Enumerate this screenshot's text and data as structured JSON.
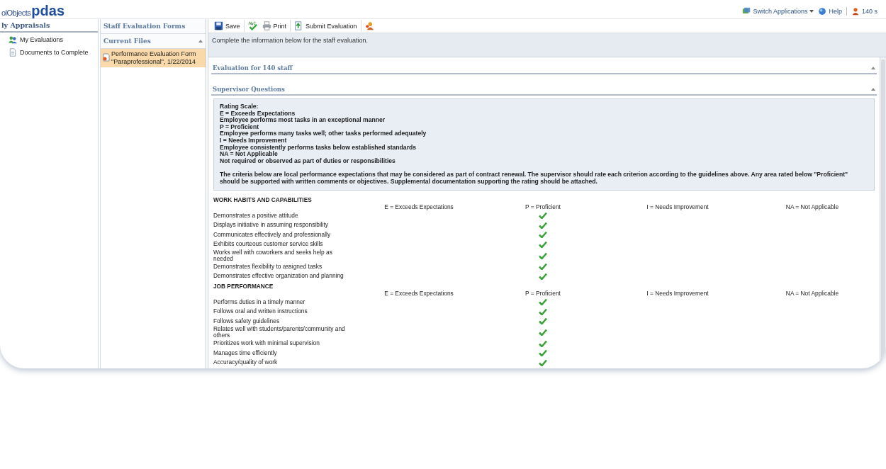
{
  "header": {
    "logo_prefix": "olObjects",
    "logo_main": "pdas",
    "links": [
      {
        "kind": "switch",
        "label": "Switch Applications"
      },
      {
        "kind": "help",
        "label": "Help"
      },
      {
        "kind": "user",
        "label": "140 s"
      }
    ]
  },
  "sidebar": {
    "title": "ly Appraisals",
    "items": [
      {
        "kind": "people",
        "label": "My Evaluations"
      },
      {
        "kind": "document",
        "label": "Documents to Complete"
      }
    ]
  },
  "files_panel": {
    "title": "Staff Evaluation Forms",
    "section": "Current Files",
    "files": [
      {
        "label": "Performance Evaluation Form \"Paraprofessional\", 1/22/2014",
        "selected": true
      }
    ]
  },
  "toolbar": [
    {
      "kind": "save",
      "label": "Save"
    },
    {
      "kind": "spellcheck"
    },
    {
      "kind": "print",
      "label": "Print"
    },
    {
      "kind": "submit",
      "label": "Submit Evaluation"
    },
    {
      "kind": "person"
    }
  ],
  "instructions": "Complete the information below for the staff evaluation.",
  "evaluation_title": "Evaluation for 140 staff",
  "questions_title": "Supervisor Questions",
  "rating_scale": [
    "Rating Scale:",
    "E = Exceeds Expectations",
    "Employee performs most tasks in an exceptional manner",
    "P = Proficient",
    "Employee performs many tasks well; other tasks performed adequately",
    "I = Needs Improvement",
    "Employee consistently performs tasks below established standards",
    "NA = Not Applicable",
    "Not required or observed as part of duties or responsibilities"
  ],
  "criteria_note": "The criteria below are local performance expectations that may be considered as part of contract renewal. The supervisor should rate each criterion according to the guidelines above. Any area rated below \"Proficient\" should be supported with written comments or objectives. Supplemental documentation supporting the rating should be attached.",
  "sections": [
    {
      "title": "WORK HABITS AND CAPABILITIES",
      "columns": [
        "E = Exceeds Expectations",
        "P = Proficient",
        "I = Needs Improvement",
        "NA = Not Applicable"
      ],
      "criteria": [
        {
          "label": "Demonstrates a positive attitude",
          "checked": [
            false,
            true,
            false,
            false
          ]
        },
        {
          "label": "Displays initiative in assuming responsibility",
          "checked": [
            false,
            true,
            false,
            false
          ]
        },
        {
          "label": "Communicates effectively and professionally",
          "checked": [
            false,
            true,
            false,
            false
          ]
        },
        {
          "label": "Exhibits courteous customer service skills",
          "checked": [
            false,
            true,
            false,
            false
          ]
        },
        {
          "label": "Works well with coworkers and seeks help as needed",
          "checked": [
            false,
            true,
            false,
            false
          ]
        },
        {
          "label": "Demonstrates flexibility to assigned tasks",
          "checked": [
            false,
            true,
            false,
            false
          ]
        },
        {
          "label": "Demonstrates effective organization and planning",
          "checked": [
            false,
            true,
            false,
            false
          ]
        }
      ]
    },
    {
      "title": "JOB PERFORMANCE",
      "columns": [
        "E = Exceeds Expectations",
        "P = Proficient",
        "I = Needs Improvement",
        "NA = Not Applicable"
      ],
      "criteria": [
        {
          "label": "Performs duties in a timely manner",
          "checked": [
            false,
            true,
            false,
            false
          ]
        },
        {
          "label": "Follows oral and written instructions",
          "checked": [
            false,
            true,
            false,
            false
          ]
        },
        {
          "label": "Follows safety guidelines",
          "checked": [
            false,
            true,
            false,
            false
          ]
        },
        {
          "label": "Relates well with students/parents/community and others",
          "checked": [
            false,
            true,
            false,
            false
          ]
        },
        {
          "label": "Prioritizes work with minimal supervision",
          "checked": [
            false,
            true,
            false,
            false
          ]
        },
        {
          "label": "Manages time efficiently",
          "checked": [
            false,
            true,
            false,
            false
          ]
        },
        {
          "label": "Accuracy/quality of work",
          "checked": [
            false,
            true,
            false,
            false
          ]
        }
      ]
    }
  ]
}
